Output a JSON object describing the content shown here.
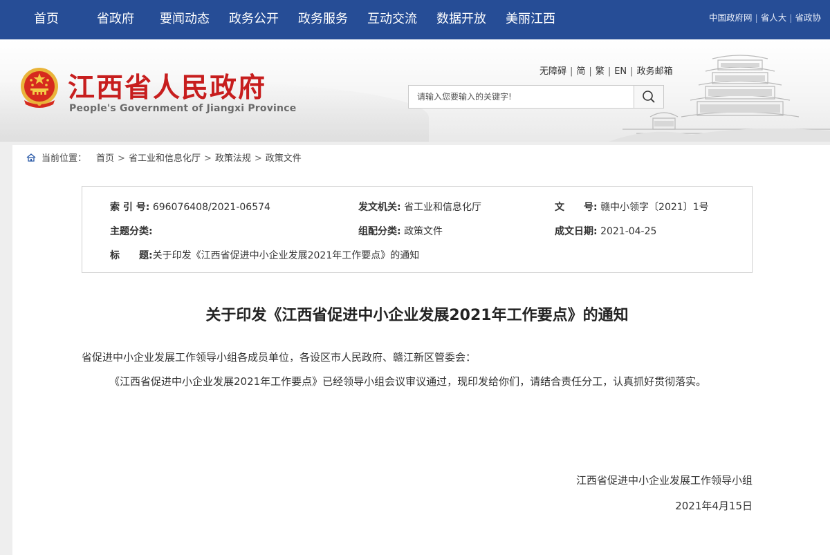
{
  "nav": {
    "items": [
      "首页",
      "省政府",
      "要闻动态",
      "政务公开",
      "政务服务",
      "互动交流",
      "数据开放",
      "美丽江西"
    ],
    "external_links": [
      "中国政府网",
      "省人大",
      "省政协"
    ]
  },
  "header": {
    "title": "江西省人民政府",
    "subtitle": "People's Government of Jiangxi Province",
    "util_links": [
      "无障碍",
      "简",
      "繁",
      "EN",
      "政务邮箱"
    ],
    "search_placeholder": "请输入您要输入的关键字!"
  },
  "breadcrumb": {
    "label": "当前位置：",
    "items": [
      "首页",
      "省工业和信息化厅",
      "政策法规",
      "政策文件"
    ]
  },
  "meta": {
    "index_label": "索 引 号:",
    "index_value": "696076408/2021-06574",
    "issuer_label": "发文机关:",
    "issuer_value": "省工业和信息化厅",
    "docno_label": "文　　号:",
    "docno_value": "赣中小领字〔2021〕1号",
    "topic_label": "主题分类:",
    "topic_value": "",
    "category_label": "组配分类:",
    "category_value": "政策文件",
    "date_label": "成文日期:",
    "date_value": "2021-04-25",
    "title_label": "标　　题:",
    "title_value": "关于印发《江西省促进中小企业发展2021年工作要点》的通知"
  },
  "article": {
    "title": "关于印发《江西省促进中小企业发展2021年工作要点》的通知",
    "salutation": "省促进中小企业发展工作领导小组各成员单位，各设区市人民政府、赣江新区管委会：",
    "body": "《江西省促进中小企业发展2021年工作要点》已经领导小组会议审议通过，现印发给你们，请结合责任分工，认真抓好贯彻落实。",
    "signature": "江西省促进中小企业发展工作领导小组",
    "date": "2021年4月15日"
  },
  "colors": {
    "nav_bg": "#264d96",
    "title_red": "#c71e1e",
    "emblem_gold": "#e9b43a"
  }
}
